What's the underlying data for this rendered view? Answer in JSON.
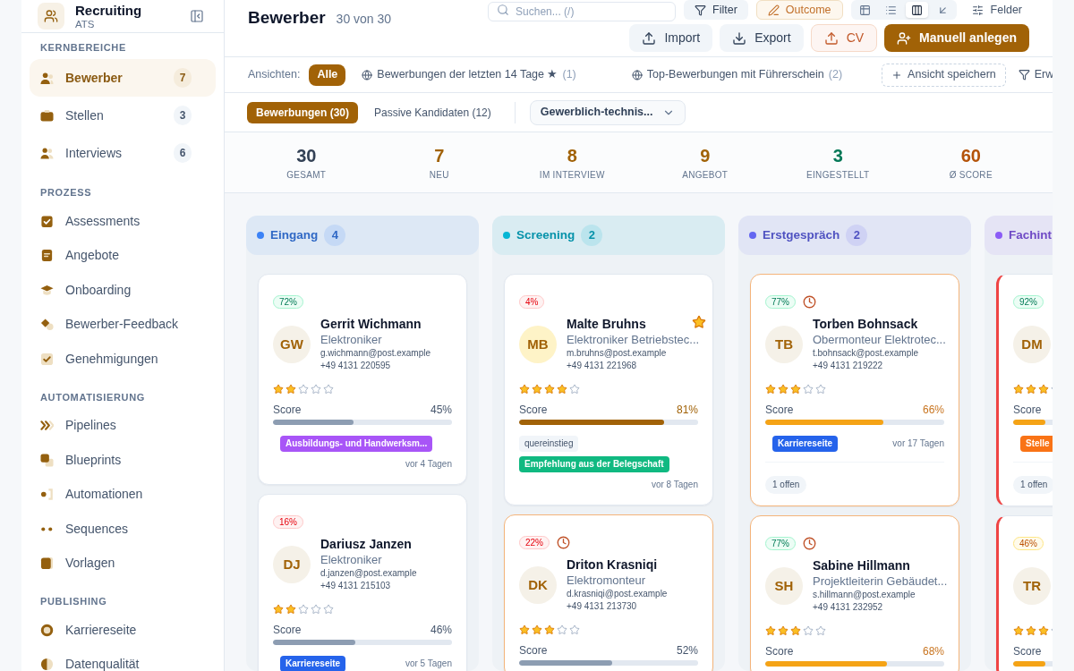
{
  "sidebar": {
    "app": {
      "title": "Recruiting",
      "subtitle": "ATS"
    },
    "sections": [
      {
        "title": "KERNBEREICHE",
        "items": [
          {
            "label": "Bewerber",
            "badge": "7",
            "selected": true
          },
          {
            "label": "Stellen",
            "badge": "3",
            "selected": false
          },
          {
            "label": "Interviews",
            "badge": "6",
            "selected": false
          }
        ]
      },
      {
        "title": "PROZESS",
        "items": [
          {
            "label": "Assessments",
            "selected": false
          },
          {
            "label": "Angebote",
            "selected": false
          },
          {
            "label": "Onboarding",
            "selected": false
          },
          {
            "label": "Bewerber-Feedback",
            "selected": false
          },
          {
            "label": "Genehmigungen",
            "selected": false
          }
        ]
      },
      {
        "title": "AUTOMATISIERUNG",
        "items": [
          {
            "label": "Pipelines",
            "selected": false
          },
          {
            "label": "Blueprints",
            "selected": false
          },
          {
            "label": "Automationen",
            "selected": false
          },
          {
            "label": "Sequences",
            "selected": false
          },
          {
            "label": "Vorlagen",
            "selected": false
          }
        ]
      },
      {
        "title": "PUBLISHING",
        "items": [
          {
            "label": "Karriereseite",
            "selected": false
          },
          {
            "label": "Datenqualität",
            "selected": false
          }
        ]
      }
    ]
  },
  "header": {
    "title": "Bewerber",
    "count": "30 von 30",
    "search": {
      "placeholder": "Suchen... (/)"
    },
    "toolbar": [
      {
        "label": "Filter",
        "kind": "filter"
      },
      {
        "label": "Outcome",
        "kind": "outcome"
      }
    ],
    "view_modes": [
      {
        "selected": false
      },
      {
        "selected": false
      },
      {
        "selected": true
      },
      {
        "selected": false
      }
    ],
    "fields_button": "Felder",
    "actions": [
      {
        "label": "Import",
        "kind": "import"
      },
      {
        "label": "Export",
        "kind": "export"
      },
      {
        "label": "CV",
        "kind": "cv"
      },
      {
        "label": "Manuell anlegen",
        "kind": "create"
      }
    ]
  },
  "views": {
    "label": "Ansichten:",
    "items": [
      {
        "label": "Alle",
        "kind": "all",
        "selected": true
      },
      {
        "label": "Bewerbungen der letzten 14 Tage ★",
        "count": "(1)",
        "kind": "shared",
        "selected": false
      },
      {
        "label": "Top-Bewerbungen mit Führerschein",
        "count": "(2)",
        "kind": "shared",
        "selected": false
      }
    ],
    "save_button": "Ansicht speichern",
    "extended_filter": "Erw"
  },
  "tabs": [
    {
      "label": "Bewerbungen (30)",
      "selected": true
    },
    {
      "label": "Passive Kandidaten (12)",
      "selected": false
    }
  ],
  "segment_filter": {
    "value": "Gewerblich-technis..."
  },
  "stats": [
    {
      "value": "30",
      "label": "GESAMT",
      "color": "#334155"
    },
    {
      "value": "7",
      "label": "NEU",
      "color": "#a16207"
    },
    {
      "value": "8",
      "label": "IM INTERVIEW",
      "color": "#a16207"
    },
    {
      "value": "9",
      "label": "ANGEBOT",
      "color": "#a16207"
    },
    {
      "value": "3",
      "label": "EINGESTELLT",
      "color": "#047857"
    },
    {
      "value": "60",
      "label": "Ø SCORE",
      "color": "#b45309"
    }
  ],
  "pipeline": [
    {
      "title": "Eingang",
      "count": "4",
      "color": "#3b82f6",
      "cards": [
        {
          "match": {
            "text": "72%",
            "kind": "good"
          },
          "overdue": false,
          "critical": false,
          "starred": false,
          "avatar": {
            "initials": "GW",
            "color": "#f5f1e8"
          },
          "name": "Gerrit Wichmann",
          "role": "Elektroniker",
          "email": "g.wichmann@post.example",
          "phone": "+49 4131 220595",
          "stars": 2,
          "score": {
            "label": "Score",
            "value": "45%",
            "level": 0.45,
            "kind": "low"
          },
          "tags": [
            {
              "text": "Ausbildungs- und Handwerksm...",
              "kind": "solid",
              "color": "#a855f7"
            }
          ],
          "date": "vor 4 Tagen"
        },
        {
          "match": {
            "text": "16%",
            "kind": "poor"
          },
          "overdue": false,
          "critical": false,
          "starred": false,
          "avatar": {
            "initials": "DJ",
            "color": "#f5f1e8"
          },
          "name": "Dariusz Janzen",
          "role": "Elektroniker",
          "email": "d.janzen@post.example",
          "phone": "+49 4131 215103",
          "stars": 2,
          "score": {
            "label": "Score",
            "value": "46%",
            "level": 0.46,
            "kind": "low"
          },
          "tags": [
            {
              "text": "Karriereseite",
              "kind": "solid",
              "color": "#2563eb"
            }
          ],
          "date": "vor 5 Tagen"
        }
      ]
    },
    {
      "title": "Screening",
      "count": "2",
      "color": "#06b6d4",
      "cards": [
        {
          "match": {
            "text": "4%",
            "kind": "poor"
          },
          "overdue": false,
          "critical": false,
          "starred": true,
          "avatar": {
            "initials": "MB",
            "color": "#fef3c7"
          },
          "name": "Malte Bruhns",
          "role": "Elektroniker Betriebstec...",
          "email": "m.bruhns@post.example",
          "phone": "+49 4131 221968",
          "stars": 4,
          "score": {
            "label": "Score",
            "value": "81%",
            "level": 0.81,
            "kind": "high"
          },
          "tags": [
            {
              "text": "quereinstieg",
              "kind": "soft"
            },
            {
              "text": "Empfehlung aus der Belegschaft",
              "kind": "solid",
              "color": "#10b981"
            }
          ],
          "date": "vor 8 Tagen"
        },
        {
          "match": {
            "text": "22%",
            "kind": "poor"
          },
          "overdue": true,
          "critical": false,
          "starred": false,
          "avatar": {
            "initials": "DK",
            "color": "#f5f1e8"
          },
          "name": "Driton Krasniqi",
          "role": "Elektromonteur",
          "email": "d.krasniqi@post.example",
          "phone": "+49 4131 213730",
          "stars": 3,
          "score": {
            "label": "Score",
            "value": "52%",
            "level": 0.52,
            "kind": "low"
          }
        }
      ]
    },
    {
      "title": "Erstgespräch",
      "count": "2",
      "color": "#6366f1",
      "cards": [
        {
          "match": {
            "text": "77%",
            "kind": "good"
          },
          "overdue": true,
          "critical": false,
          "starred": false,
          "avatar": {
            "initials": "TB",
            "color": "#f5f1e8"
          },
          "name": "Torben Bohnsack",
          "role": "Obermonteur Elektrotec...",
          "email": "t.bohnsack@post.example",
          "phone": "+49 4131 219222",
          "stars": 3,
          "score": {
            "label": "Score",
            "value": "66%",
            "level": 0.66,
            "kind": "mid"
          },
          "tags": [
            {
              "text": "Karriereseite",
              "kind": "solid",
              "color": "#2563eb"
            }
          ],
          "date": "vor 17 Tagen",
          "open": "1 offen"
        },
        {
          "match": {
            "text": "77%",
            "kind": "good"
          },
          "overdue": true,
          "critical": false,
          "starred": false,
          "avatar": {
            "initials": "SH",
            "color": "#f5f1e8"
          },
          "name": "Sabine Hillmann",
          "role": "Projektleiterin Gebäudet...",
          "email": "s.hillmann@post.example",
          "phone": "+49 4131 232952",
          "stars": 3,
          "score": {
            "label": "Score",
            "value": "68%",
            "level": 0.68,
            "kind": "mid"
          }
        }
      ]
    },
    {
      "title": "Fachint",
      "color": "#8b5cf6",
      "cards": [
        {
          "match": {
            "text": "92%",
            "kind": "good"
          },
          "overdue": false,
          "critical": true,
          "avatar": {
            "initials": "DM",
            "color": "#f5f1e8"
          },
          "stars": 3,
          "score": {
            "label": "Score",
            "level": 0.18,
            "kind": "mid"
          },
          "tags": [
            {
              "text": "Stelle",
              "kind": "solid",
              "color": "#f97316"
            }
          ],
          "open": "1 offen"
        },
        {
          "match": {
            "text": "46%",
            "kind": "fair"
          },
          "overdue": false,
          "critical": true,
          "avatar": {
            "initials": "TR",
            "color": "#f5f1e8"
          },
          "stars": 3,
          "score": {
            "label": "Score",
            "level": 0.18,
            "kind": "mid"
          }
        }
      ]
    }
  ]
}
